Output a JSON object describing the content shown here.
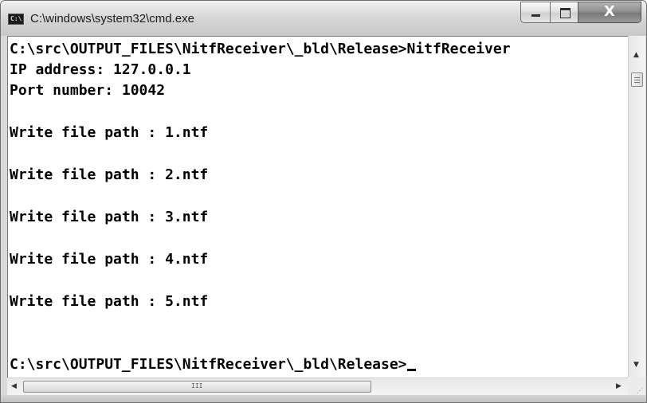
{
  "window": {
    "title": "C:\\windows\\system32\\cmd.exe",
    "app_icon_text": "C:\\",
    "minimize_icon": "minimize-icon",
    "maximize_icon": "maximize-icon",
    "close_icon": "close-icon",
    "close_glyph": "X"
  },
  "console": {
    "lines": [
      "C:\\src\\OUTPUT_FILES\\NitfReceiver\\_bld\\Release>NitfReceiver",
      "IP address: 127.0.0.1",
      "Port number: 10042",
      "",
      "Write file path : 1.ntf",
      "",
      "Write file path : 2.ntf",
      "",
      "Write file path : 3.ntf",
      "",
      "Write file path : 4.ntf",
      "",
      "Write file path : 5.ntf",
      "",
      "",
      "C:\\src\\OUTPUT_FILES\\NitfReceiver\\_bld\\Release>"
    ],
    "background": "#ffffff",
    "text_color": "#000000"
  },
  "scrollbars": {
    "up_arrow": "▲",
    "down_arrow": "▼",
    "left_arrow": "◀",
    "right_arrow": "▶",
    "h_grip": "III"
  }
}
